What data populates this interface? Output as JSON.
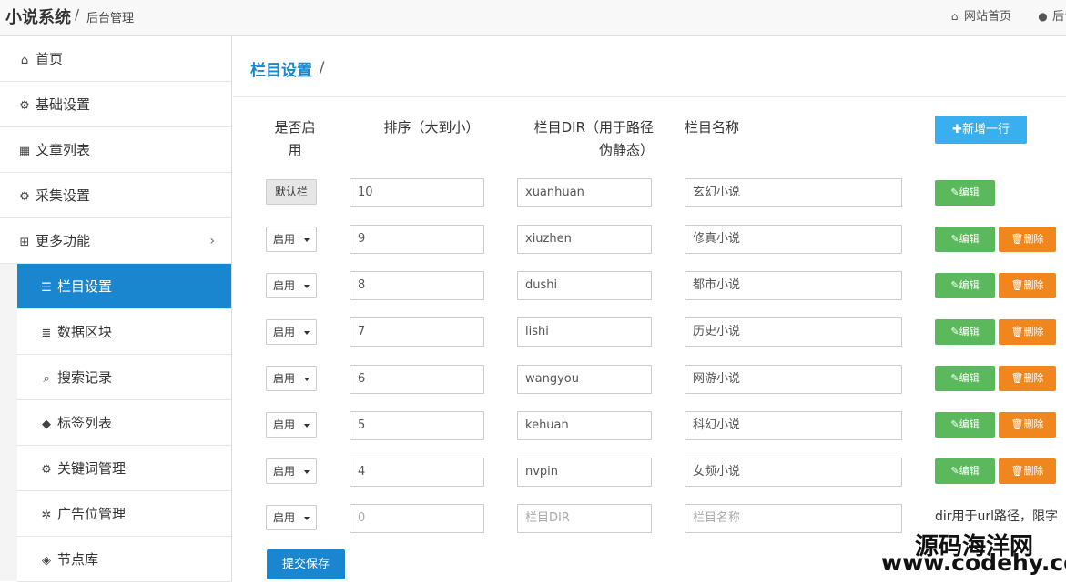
{
  "header": {
    "brand": "小说系统",
    "separator": "/",
    "subtitle": "后台管理",
    "home_link": "网站首页",
    "home_icon": "home-icon",
    "user_link": "后台",
    "user_icon": "user-icon"
  },
  "sidebar": {
    "items": [
      {
        "label": "首页",
        "icon": "home-icon"
      },
      {
        "label": "基础设置",
        "icon": "gear-icon"
      },
      {
        "label": "文章列表",
        "icon": "table-icon"
      },
      {
        "label": "采集设置",
        "icon": "gears-icon"
      },
      {
        "label": "更多功能",
        "icon": "sitemap-icon"
      }
    ],
    "sub_items": [
      {
        "label": "栏目设置",
        "icon": "list-icon"
      },
      {
        "label": "数据区块",
        "icon": "database-icon"
      },
      {
        "label": "搜索记录",
        "icon": "search-icon"
      },
      {
        "label": "标签列表",
        "icon": "tag-icon"
      },
      {
        "label": "关键词管理",
        "icon": "gears-icon"
      },
      {
        "label": "广告位管理",
        "icon": "sliders-icon"
      },
      {
        "label": "节点库",
        "icon": "cube-icon"
      }
    ],
    "active": "栏目设置",
    "colors": {
      "active_bg": "#1a86cf"
    }
  },
  "page": {
    "title": "栏目设置",
    "slash": "/"
  },
  "table": {
    "headers": {
      "enabled_line1": "是否启",
      "enabled_line2": "用",
      "sort": "排序（大到小）",
      "dir_line1": "栏目DIR（用于路径",
      "dir_line2": "伪静态）",
      "name": "栏目名称"
    },
    "add_button": "✚新增一行",
    "edit_label": "✎编辑",
    "delete_label": "🗑删除",
    "default_label": "默认栏",
    "rows": [
      {
        "status": "默认栏",
        "sort": "10",
        "dir": "xuanhuan",
        "name": "玄幻小说",
        "deletable": false
      },
      {
        "status": "启用",
        "sort": "9",
        "dir": "xiuzhen",
        "name": "修真小说",
        "deletable": true
      },
      {
        "status": "启用",
        "sort": "8",
        "dir": "dushi",
        "name": "都市小说",
        "deletable": true
      },
      {
        "status": "启用",
        "sort": "7",
        "dir": "lishi",
        "name": "历史小说",
        "deletable": true
      },
      {
        "status": "启用",
        "sort": "6",
        "dir": "wangyou",
        "name": "网游小说",
        "deletable": true
      },
      {
        "status": "启用",
        "sort": "5",
        "dir": "kehuan",
        "name": "科幻小说",
        "deletable": true
      },
      {
        "status": "启用",
        "sort": "4",
        "dir": "nvpin",
        "name": "女频小说",
        "deletable": true
      }
    ],
    "new_row": {
      "status": "启用",
      "sort_placeholder": "0",
      "dir_placeholder": "栏目DIR",
      "name_placeholder": "栏目名称",
      "hint": "dir用于url路径，限字"
    },
    "submit_button": "提交保存",
    "colors": {
      "edit": "#5cb85c",
      "delete": "#f0871e",
      "add": "#3aaff0",
      "submit": "#1a86cf"
    }
  },
  "watermark": {
    "line1": "源码海洋网",
    "line2": "www.codehy.com"
  }
}
